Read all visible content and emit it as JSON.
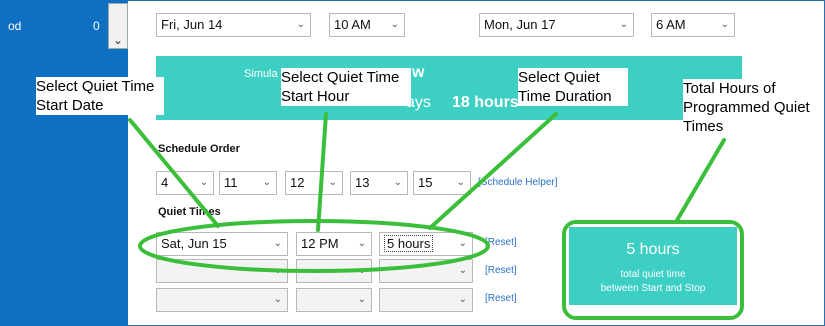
{
  "sidebar": {
    "label": "od",
    "count": "0",
    "dropdown_glyph": "⌄"
  },
  "top_row": {
    "start_date": "Fri, Jun 14",
    "start_hour": "10 AM",
    "end_date": "Mon, Jun 17",
    "end_hour": "6 AM"
  },
  "banner": {
    "line1": "Simula",
    "line1b": "w",
    "days_text": "ays",
    "hours_text": "18 hours"
  },
  "callouts": {
    "start_date": "Select Quiet Time Start Date",
    "start_hour": "Select Quiet Time Start Hour",
    "duration": "Select Quiet Time Duration",
    "total": "Total Hours of Programmed Quiet Times"
  },
  "schedule_order": {
    "title": "Schedule Order",
    "values": [
      "4",
      "11",
      "12",
      "13",
      "15"
    ],
    "helper_link": "[Schedule Helper]"
  },
  "quiet_times": {
    "title": "Quiet Times",
    "rows": [
      {
        "date": "Sat, Jun 15",
        "hour": "12 PM",
        "duration": "5 hours",
        "reset": "[Reset]"
      },
      {
        "date": "",
        "hour": "",
        "duration": "",
        "reset": "[Reset]"
      },
      {
        "date": "",
        "hour": "",
        "duration": "",
        "reset": "[Reset]"
      }
    ]
  },
  "total": {
    "value": "5  hours",
    "line1": "total quiet time",
    "line2": "between Start and Stop"
  },
  "colors": {
    "sidebar": "#0f6fc0",
    "teal": "#3ecfc4",
    "highlight_green": "#3bbf3b",
    "link": "#2b72c8"
  },
  "icons": {
    "chevron": "chevron-down-icon"
  }
}
